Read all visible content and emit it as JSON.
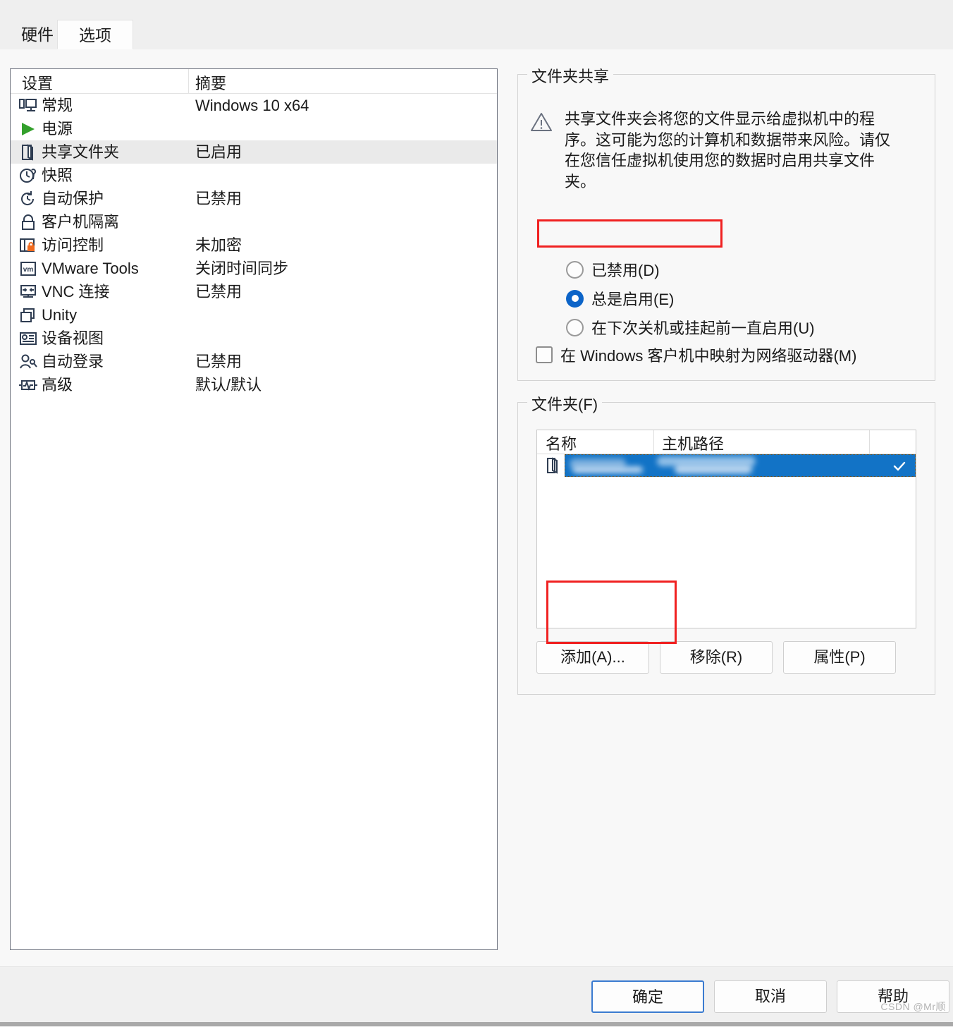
{
  "tabs": [
    {
      "label": "硬件",
      "active": false
    },
    {
      "label": "选项",
      "active": true
    }
  ],
  "settings_list": {
    "columns": {
      "name": "设置",
      "summary": "摘要"
    },
    "rows": [
      {
        "icon": "monitor-icon",
        "label": "常规",
        "summary": "Windows 10 x64",
        "selected": false
      },
      {
        "icon": "play-icon",
        "label": "电源",
        "summary": "",
        "selected": false
      },
      {
        "icon": "shared-folder-icon",
        "label": "共享文件夹",
        "summary": "已启用",
        "selected": true
      },
      {
        "icon": "snapshot-icon",
        "label": "快照",
        "summary": "",
        "selected": false
      },
      {
        "icon": "autoprotect-icon",
        "label": "自动保护",
        "summary": "已禁用",
        "selected": false
      },
      {
        "icon": "lock-icon",
        "label": "客户机隔离",
        "summary": "",
        "selected": false
      },
      {
        "icon": "access-lock-icon",
        "label": "访问控制",
        "summary": "未加密",
        "selected": false
      },
      {
        "icon": "vmware-tools-icon",
        "label": "VMware Tools",
        "summary": "关闭时间同步",
        "selected": false
      },
      {
        "icon": "vnc-icon",
        "label": "VNC 连接",
        "summary": "已禁用",
        "selected": false
      },
      {
        "icon": "unity-icon",
        "label": "Unity",
        "summary": "",
        "selected": false
      },
      {
        "icon": "device-view-icon",
        "label": "设备视图",
        "summary": "",
        "selected": false
      },
      {
        "icon": "autologin-icon",
        "label": "自动登录",
        "summary": "已禁用",
        "selected": false
      },
      {
        "icon": "advanced-icon",
        "label": "高级",
        "summary": "默认/默认",
        "selected": false
      }
    ]
  },
  "folder_sharing": {
    "group_title": "文件夹共享",
    "warning_text": "共享文件夹会将您的文件显示给虚拟机中的程序。这可能为您的计算机和数据带来风险。请仅在您信任虚拟机使用您的数据时启用共享文件夹。",
    "options": [
      {
        "label": "已禁用(D)",
        "selected": false
      },
      {
        "label": "总是启用(E)",
        "selected": true
      },
      {
        "label": "在下次关机或挂起前一直启用(U)",
        "selected": false
      }
    ],
    "map_checkbox": {
      "label": "在 Windows 客户机中映射为网络驱动器(M)",
      "checked": false
    }
  },
  "folders": {
    "group_title": "文件夹(F)",
    "columns": {
      "name": "名称",
      "host_path": "主机路径"
    },
    "rows": [
      {
        "name": "",
        "host_path": "",
        "enabled": true,
        "redacted": true,
        "selected": true
      }
    ],
    "buttons": {
      "add": "添加(A)...",
      "remove": "移除(R)",
      "properties": "属性(P)"
    }
  },
  "footer": {
    "ok": "确定",
    "cancel": "取消",
    "help": "帮助"
  },
  "watermark": "CSDN @Mr顺",
  "colors": {
    "accent_blue": "#0c64c8",
    "selection_blue": "#1273c6",
    "annotation_red": "#f02121",
    "row_highlight": "#eaeaea",
    "icon_outline": "#2f3d52"
  }
}
